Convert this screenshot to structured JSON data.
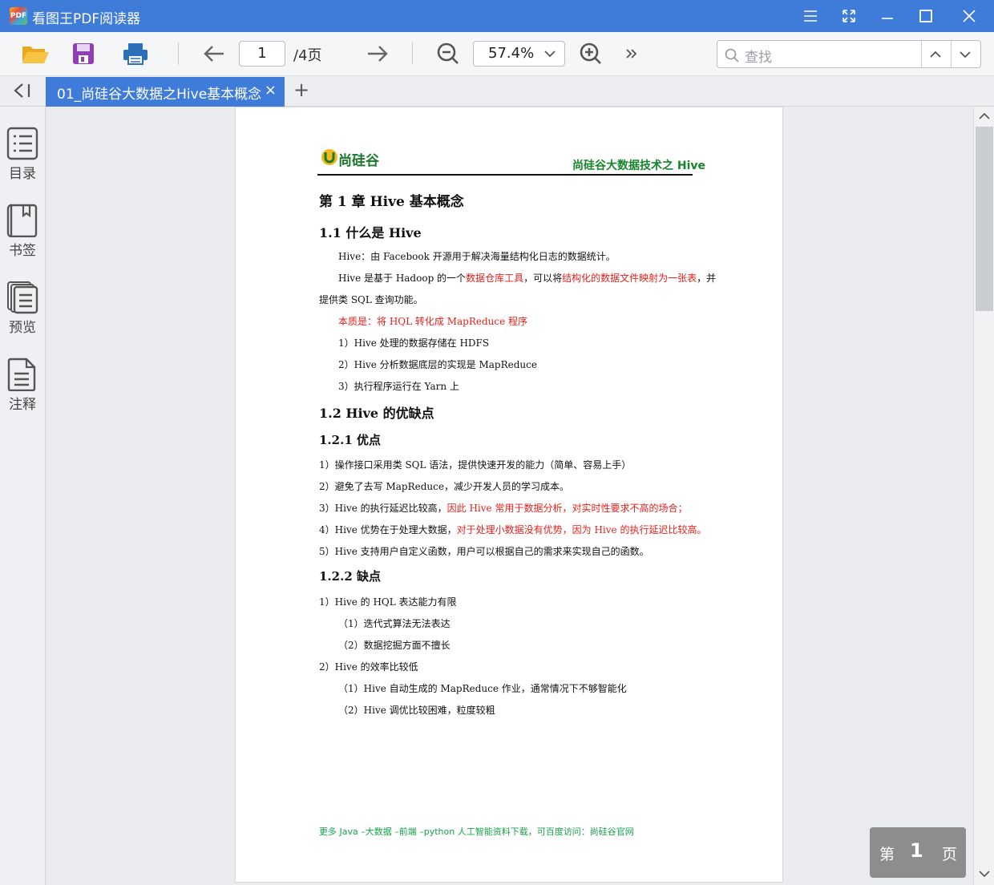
{
  "app": {
    "title": "看图王PDF阅读器",
    "logo_text": "PDF"
  },
  "toolbar": {
    "page_current": "1",
    "page_total": "/4页",
    "zoom": "57.4%",
    "search_placeholder": "查找"
  },
  "tabs": [
    {
      "label": "01_尚硅谷大数据之Hive基本概念",
      "close": "×"
    }
  ],
  "tab_add": "+",
  "sidebar": {
    "items": [
      {
        "label": "目录"
      },
      {
        "label": "书签"
      },
      {
        "label": "预览"
      },
      {
        "label": "注释"
      }
    ]
  },
  "document": {
    "logo_text": "尚硅谷",
    "header_right": "尚硅谷大数据技术之 Hive",
    "h1": "第 1 章  Hive 基本概念",
    "s1_title": "1.1  什么是 Hive",
    "s1_p1": "Hive：由 Facebook 开源用于解决海量结构化日志的数据统计。",
    "s1_p2_a": "Hive 是基于 Hadoop 的一个",
    "s1_p2_b": "数据仓库工具",
    "s1_p2_c": "，可以将",
    "s1_p2_d": "结构化的数据文件映射为一张表",
    "s1_p2_e": "，并",
    "s1_p2_f": "提供类 SQL 查询功能。",
    "s1_p3": "本质是：将 HQL 转化成 MapReduce 程序",
    "s1_l1": "1）Hive 处理的数据存储在 HDFS",
    "s1_l2": "2）Hive 分析数据底层的实现是 MapReduce",
    "s1_l3": "3）执行程序运行在 Yarn 上",
    "s2_title": "1.2 Hive 的优缺点",
    "s21_title": "1.2.1  优点",
    "s21_l1": "1）操作接口采用类 SQL 语法，提供快速开发的能力（简单、容易上手）",
    "s21_l2": "2）避免了去写 MapReduce，减少开发人员的学习成本。",
    "s21_l3_a": "3）Hive 的执行延迟比较高，",
    "s21_l3_b": "因此 Hive 常用于数据分析，对实时性要求不高的场合；",
    "s21_l4_a": "4）Hive 优势在于处理大数据，",
    "s21_l4_b": "对于处理小数据没有优势，因为 Hive 的执行延迟比较高。",
    "s21_l5": "5）Hive 支持用户自定义函数，用户可以根据自己的需求来实现自己的函数。",
    "s22_title": "1.2.2  缺点",
    "s22_l1": "1）Hive 的 HQL 表达能力有限",
    "s22_l1a": "（1）迭代式算法无法表达",
    "s22_l1b": "（2）数据挖掘方面不擅长",
    "s22_l2": "2）Hive 的效率比较低",
    "s22_l2a": "（1）Hive 自动生成的 MapReduce 作业，通常情况下不够智能化",
    "s22_l2b": "（2）Hive 调优比较困难，粒度较粗",
    "footer": "更多 Java –大数据 –前端 –python 人工智能资料下载，可百度访问：尚硅谷官网"
  },
  "page_badge": {
    "prefix": "第",
    "number": "1",
    "suffix": "页"
  },
  "colors": {
    "accent": "#3f7bd9",
    "highlight_red": "#e5211c",
    "green": "#16852b"
  }
}
